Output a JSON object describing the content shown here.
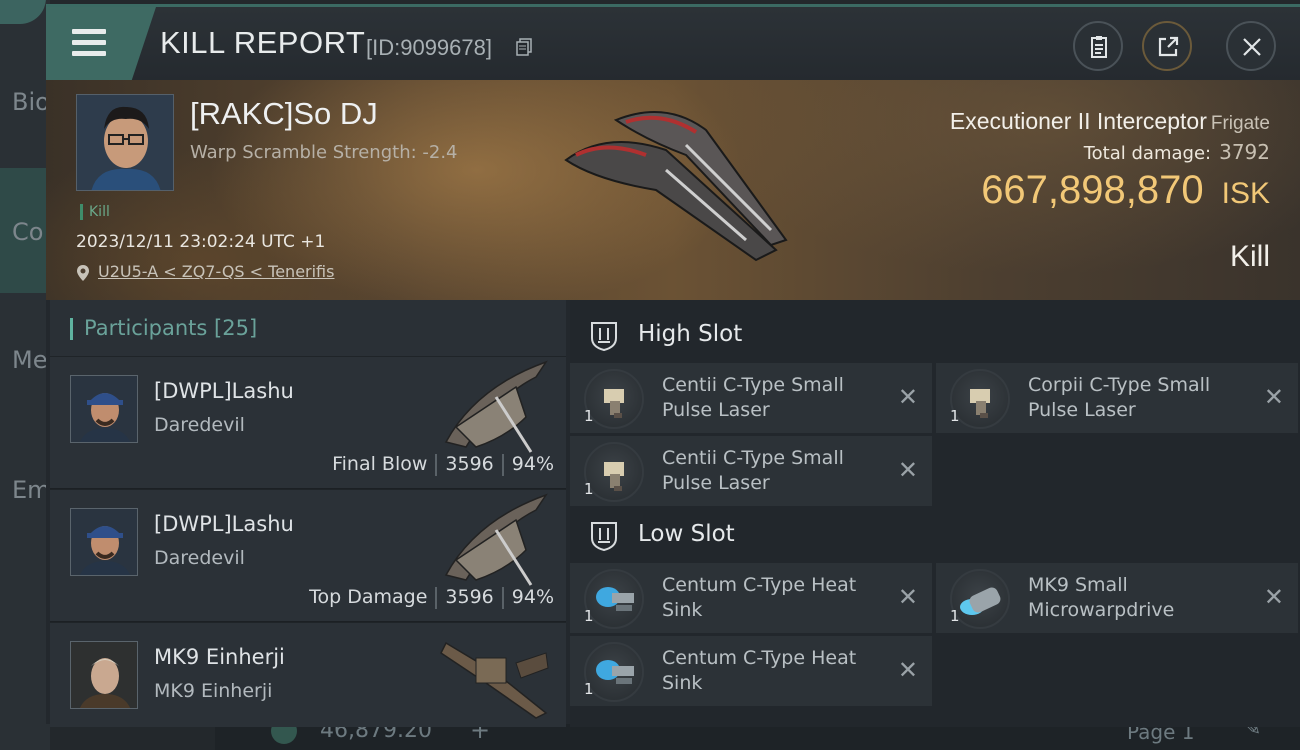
{
  "background": {
    "left_items": [
      "Bio",
      "Co",
      "Me",
      "Em"
    ],
    "bottom_amount": "46,879.20",
    "bottom_page": "Page 1"
  },
  "window": {
    "title": "KILL REPORT",
    "report_id": "[ID:9099678]"
  },
  "victim": {
    "name": "[RAKC]So DJ",
    "warp_scramble": "Warp Scramble Strength: -2.4",
    "tag": "Kill",
    "timestamp": "2023/12/11 23:02:24 UTC +1",
    "location": "U2U5-A < ZQ7-QS < Tenerifis",
    "ship_name": "Executioner II Interceptor",
    "ship_class": "Frigate",
    "total_damage_label": "Total damage:",
    "total_damage": "3792",
    "isk_value": "667,898,870",
    "isk_unit": "ISK",
    "result": "Kill"
  },
  "participants": {
    "label": "Participants",
    "count": "[25]",
    "rows": [
      {
        "name": "[DWPL]Lashu",
        "ship": "Daredevil",
        "role": "Final Blow",
        "damage": "3596",
        "percent": "94%"
      },
      {
        "name": "[DWPL]Lashu",
        "ship": "Daredevil",
        "role": "Top Damage",
        "damage": "3596",
        "percent": "94%"
      },
      {
        "name": "MK9 Einherji",
        "ship": "MK9 Einherji",
        "role": "",
        "damage": "",
        "percent": ""
      }
    ]
  },
  "fitting": {
    "high_slot_label": "High Slot",
    "low_slot_label": "Low Slot",
    "high": [
      {
        "name": "Centii C-Type Small Pulse Laser",
        "qty": "1"
      },
      {
        "name": "Corpii C-Type Small Pulse Laser",
        "qty": "1"
      },
      {
        "name": "Centii C-Type Small Pulse Laser",
        "qty": "1"
      }
    ],
    "low": [
      {
        "name": "Centum C-Type Heat Sink",
        "qty": "1"
      },
      {
        "name": "MK9 Small Microwarpdrive",
        "qty": "1"
      },
      {
        "name": "Centum C-Type Heat Sink",
        "qty": "1"
      }
    ]
  },
  "colors": {
    "accent": "#3e6a63",
    "isk": "#f2c877",
    "participants_label": "#6aa29a"
  }
}
